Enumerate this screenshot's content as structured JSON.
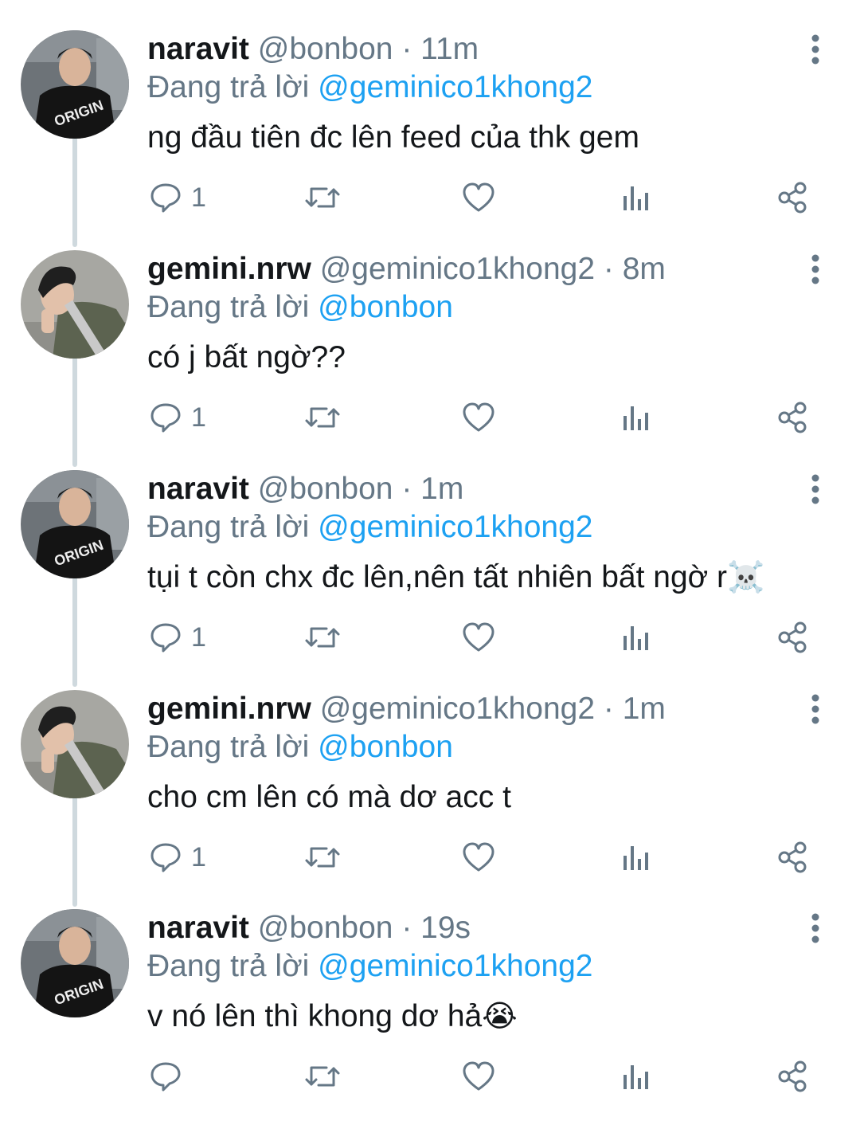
{
  "tweets": [
    {
      "display_name": "naravit",
      "handle": "@bonbon",
      "separator": "·",
      "time": "11m",
      "reply_prefix": "Đang trả lời",
      "reply_to": "@geminico1khong2",
      "text": "ng đầu tiên đc lên feed của thk gem",
      "emoji": "",
      "reply_count": "1",
      "avatar": "avatar-naravit"
    },
    {
      "display_name": "gemini.nrw",
      "handle": "@geminico1khong2",
      "separator": "·",
      "time": "8m",
      "reply_prefix": "Đang trả lời",
      "reply_to": "@bonbon",
      "text": "có j bất ngờ??",
      "emoji": "",
      "reply_count": "1",
      "avatar": "avatar-gemini"
    },
    {
      "display_name": "naravit",
      "handle": "@bonbon",
      "separator": "·",
      "time": "1m",
      "reply_prefix": "Đang trả lời",
      "reply_to": "@geminico1khong2",
      "text": "tụi t còn chx đc lên,nên tất nhiên bất ngờ r",
      "emoji": "☠️",
      "reply_count": "1",
      "avatar": "avatar-naravit"
    },
    {
      "display_name": "gemini.nrw",
      "handle": "@geminico1khong2",
      "separator": "·",
      "time": "1m",
      "reply_prefix": "Đang trả lời",
      "reply_to": "@bonbon",
      "text": "cho cm lên có mà dơ acc t",
      "emoji": "",
      "reply_count": "1",
      "avatar": "avatar-gemini"
    },
    {
      "display_name": "naravit",
      "handle": "@bonbon",
      "separator": "·",
      "time": "19s",
      "reply_prefix": "Đang trả lời",
      "reply_to": "@geminico1khong2",
      "text": "v nó lên thì khong dơ hả",
      "emoji": "😭",
      "reply_count": "",
      "avatar": "avatar-naravit"
    }
  ],
  "icons": {
    "reply": "reply-icon",
    "retweet": "retweet-icon",
    "like": "like-icon",
    "analytics": "analytics-icon",
    "share": "share-icon",
    "more": "more-vertical-icon"
  },
  "colors": {
    "link": "#1da1f2",
    "muted": "#657786",
    "text": "#14171a",
    "thread_line": "#cfd9de"
  }
}
